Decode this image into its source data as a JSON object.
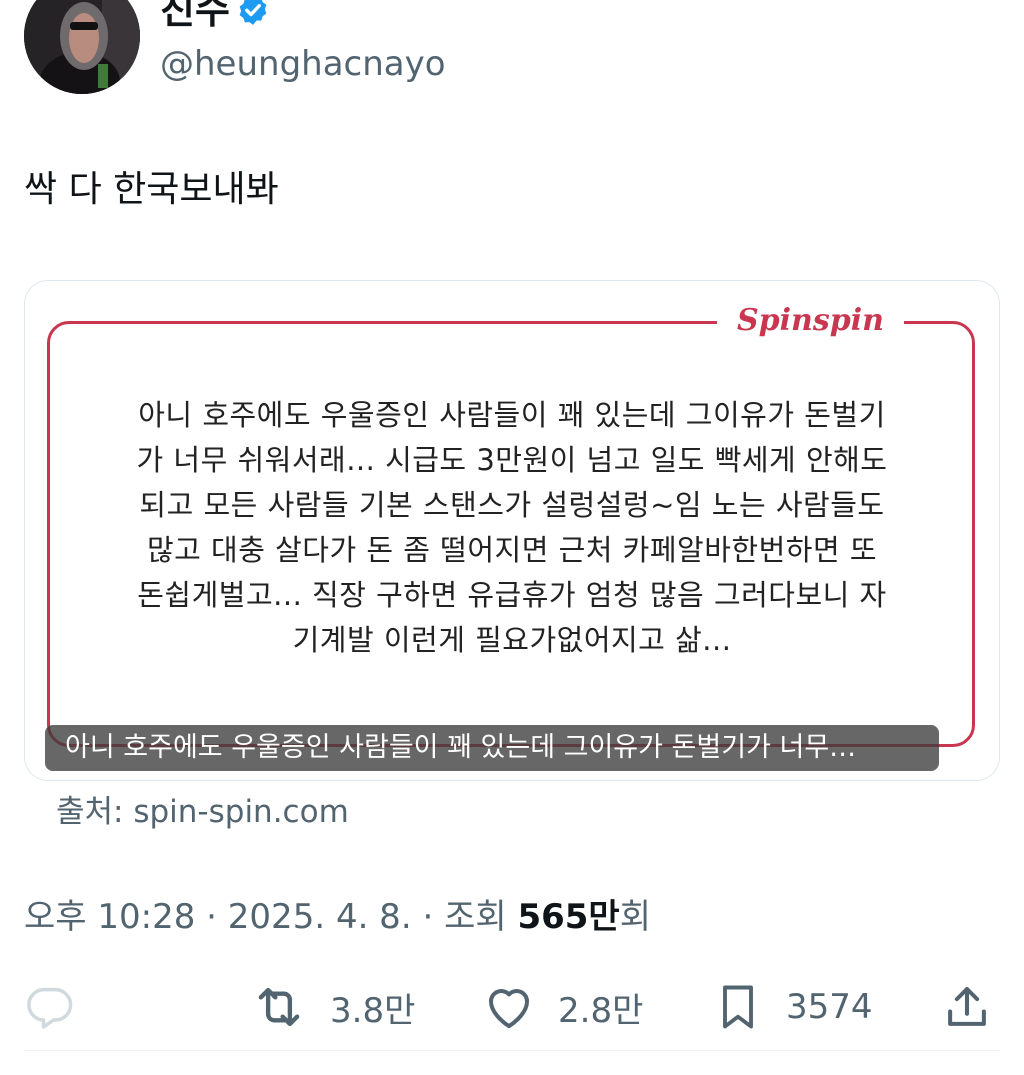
{
  "author": {
    "display_name": "진수",
    "handle": "@heunghacnayo"
  },
  "tweet": {
    "text": "싹 다 한국보내봐"
  },
  "card": {
    "brand": "Spinspin",
    "quote_lines": [
      "아니 호주에도 우울증인 사람들이 꽤 있는데 그이유가 돈벌기",
      "가 너무 쉬워서래... 시급도 3만원이 넘고 일도 빡세게 안해도",
      "되고 모든 사람들 기본 스탠스가 설렁설렁~임 노는 사람들도",
      "많고 대충 살다가 돈 좀 떨어지면 근처 카페알바한번하면 또",
      "돈쉽게벌고... 직장 구하면 유급휴가 엄청 많음 그러다보니 자",
      "기계발 이런게 필요가없어지고 삶..."
    ],
    "caption": "아니 호주에도 우울증인 사람들이 꽤 있는데 그이유가 돈벌기가 너무…",
    "source": "출처: spin-spin.com"
  },
  "meta": {
    "time": "오후 10:28",
    "separator": "·",
    "date": "2025. 4. 8.",
    "views_label": "조회",
    "views_count": "565만",
    "views_unit": "회"
  },
  "actions": {
    "reply_icon": "reply-icon",
    "retweet_icon": "retweet-icon",
    "retweet_count": "3.8만",
    "like_icon": "heart-icon",
    "like_count": "2.8만",
    "bookmark_icon": "bookmark-icon",
    "bookmark_count": "3574",
    "share_icon": "share-icon"
  },
  "colors": {
    "verified": "#1d9bf0",
    "brand_red": "#c8364f",
    "secondary_text": "#536471"
  }
}
